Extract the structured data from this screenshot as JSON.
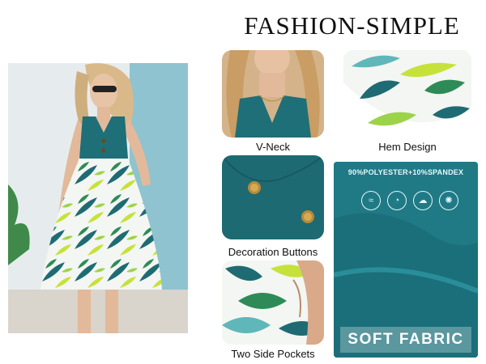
{
  "title": "FASHION-SIMPLE",
  "features": [
    {
      "caption": "V-Neck"
    },
    {
      "caption": "Hem Design"
    },
    {
      "caption": "Decoration Buttons"
    },
    {
      "caption": "Two Side Pockets"
    }
  ],
  "fabric": {
    "composition": "90%POLYESTER+10%SPANDEX",
    "label": "SOFT FABRIC",
    "icons": [
      "breathable-icon",
      "moisture-icon",
      "cloud-soft-icon",
      "temperature-icon"
    ]
  },
  "colors": {
    "dress_teal": "#1e6f78",
    "fabric_teal": "#1f7a86",
    "leaf_green": "#2e8b57",
    "leaf_yellow": "#c7e13b"
  }
}
